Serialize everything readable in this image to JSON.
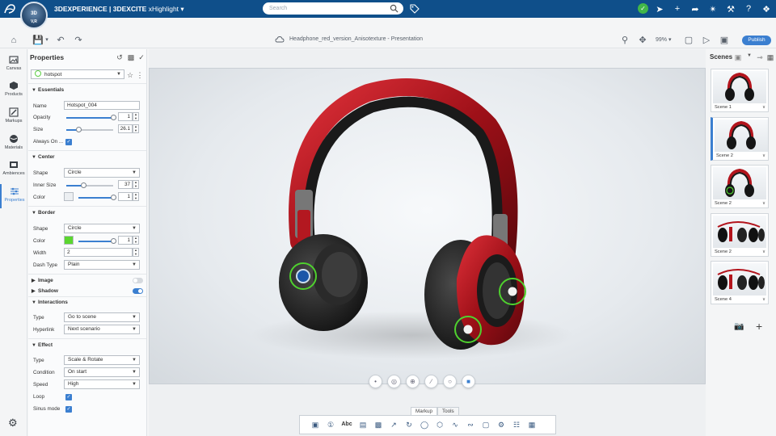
{
  "topbar": {
    "compass_3d": "3D",
    "compass_v": "V,R",
    "brand_prefix": "3DEXPERIENCE | 3DEXCITE",
    "brand_app": "xHighlight",
    "search_placeholder": "Search"
  },
  "toolbar": {
    "document_title": "Headphone_red_version_Anisotexture - Presentation",
    "zoom": "99%",
    "publish_label": "Publish"
  },
  "rail": {
    "items": [
      {
        "label": "Canvas",
        "icon": "canvas-icon"
      },
      {
        "label": "Products",
        "icon": "products-icon"
      },
      {
        "label": "Markups",
        "icon": "markups-icon"
      },
      {
        "label": "Materials",
        "icon": "materials-icon"
      },
      {
        "label": "Ambiences",
        "icon": "ambiences-icon"
      },
      {
        "label": "Properties",
        "icon": "properties-icon",
        "active": true
      }
    ]
  },
  "properties": {
    "title": "Properties",
    "object": "hotspot",
    "essentials": {
      "title": "Essentials",
      "name_label": "Name",
      "name_value": "Hotspot_004",
      "opacity_label": "Opacity",
      "opacity_value": "1",
      "opacity_fraction": 1.0,
      "size_label": "Size",
      "size_value": "26.1",
      "size_fraction": 0.26,
      "always_on_label": "Always On ..."
    },
    "center": {
      "title": "Center",
      "shape_label": "Shape",
      "shape_value": "Circle",
      "inner_size_label": "Inner Size",
      "inner_size_value": "37",
      "inner_size_fraction": 0.37,
      "color_label": "Color",
      "color_value": "1",
      "color_fraction": 1.0,
      "color_swatch": "#eceff2"
    },
    "border": {
      "title": "Border",
      "shape_label": "Shape",
      "shape_value": "Circle",
      "color_label": "Color",
      "color_value": "1",
      "color_fraction": 1.0,
      "color_swatch": "#5bd62f",
      "width_label": "Width",
      "width_value": "2",
      "dash_label": "Dash Type",
      "dash_value": "Plain"
    },
    "image": {
      "title": "Image",
      "on": false
    },
    "shadow": {
      "title": "Shadow",
      "on": true
    },
    "interactions": {
      "title": "Interactions",
      "type_label": "Type",
      "type_value": "Go to scene",
      "hyperlink_label": "Hyperlink",
      "hyperlink_value": "Next scenario"
    },
    "effect": {
      "title": "Effect",
      "type_label": "Type",
      "type_value": "Scale & Rotate",
      "condition_label": "Condition",
      "condition_value": "On start",
      "speed_label": "Speed",
      "speed_value": "High",
      "loop_label": "Loop",
      "sinus_label": "Sinus mode"
    }
  },
  "viewport": {
    "tabs": [
      "Markup",
      "Tools"
    ],
    "active_tab": "Markup",
    "markup_text_tool": "Abc"
  },
  "scenes": {
    "title": "Scenes",
    "items": [
      {
        "name": "Scene 1"
      },
      {
        "name": "Scene 2",
        "active": true
      },
      {
        "name": "Scene 2"
      },
      {
        "name": "Scene 2"
      },
      {
        "name": "Scene 4"
      }
    ]
  },
  "colors": {
    "topbar": "#0f4f8a",
    "accent": "#3b7fd0",
    "hotspot_ring": "#4fd12e",
    "headphone_red": "#b3141c"
  }
}
